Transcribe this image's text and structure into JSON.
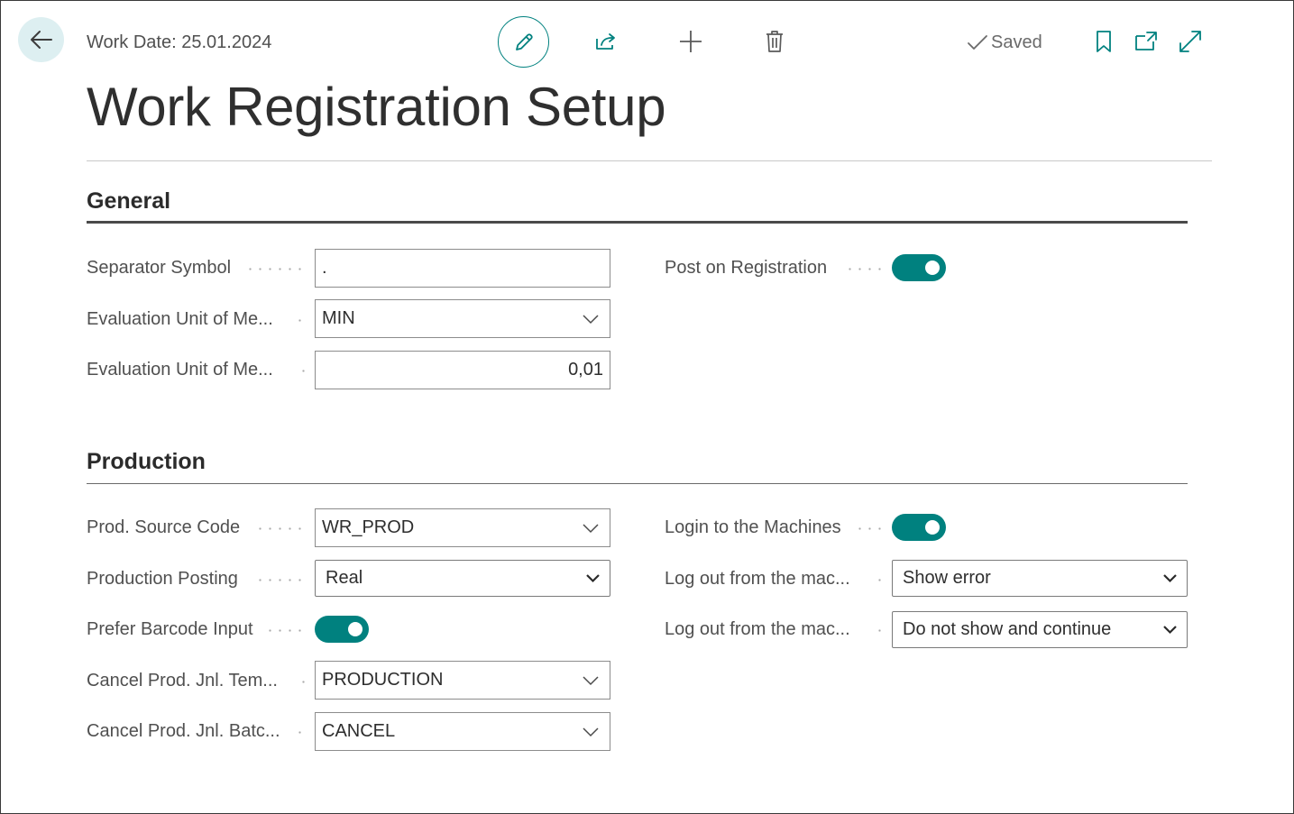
{
  "header": {
    "work_date": "Work Date: 25.01.2024",
    "saved_label": "Saved",
    "icons": [
      "arrow-left-icon",
      "pencil-icon",
      "share-icon",
      "plus-icon",
      "trash-icon",
      "checkmark-icon",
      "bookmark-icon",
      "open-new-window-icon",
      "expand-icon"
    ]
  },
  "page_title": "Work Registration Setup",
  "general": {
    "title": "General",
    "separator_symbol": {
      "label": "Separator Symbol",
      "value": "."
    },
    "eval_unit_code": {
      "label": "Evaluation Unit of Me...",
      "value": "MIN"
    },
    "eval_unit_rounding": {
      "label": "Evaluation Unit of Me...",
      "value": "0,01"
    },
    "post_on_registration": {
      "label": "Post on Registration",
      "checked": true
    }
  },
  "production": {
    "title": "Production",
    "prod_source_code": {
      "label": "Prod. Source Code",
      "value": "WR_PROD"
    },
    "production_posting": {
      "label": "Production Posting",
      "value": "Real"
    },
    "prefer_barcode_input": {
      "label": "Prefer Barcode Input",
      "checked": true
    },
    "cancel_template": {
      "label": "Cancel Prod. Jnl. Tem...",
      "value": "PRODUCTION"
    },
    "cancel_batch": {
      "label": "Cancel Prod. Jnl. Batc...",
      "value": "CANCEL"
    },
    "login_machines": {
      "label": "Login to the Machines",
      "checked": true
    },
    "logout_1": {
      "label": "Log out from the mac...",
      "value": "Show error"
    },
    "logout_2": {
      "label": "Log out from the mac...",
      "value": "Do not show and continue"
    }
  },
  "colors": {
    "accent": "#00817f",
    "back_button_bg": "#ddeff1",
    "text": "#505050",
    "section_rule": "#4a4a4a"
  }
}
